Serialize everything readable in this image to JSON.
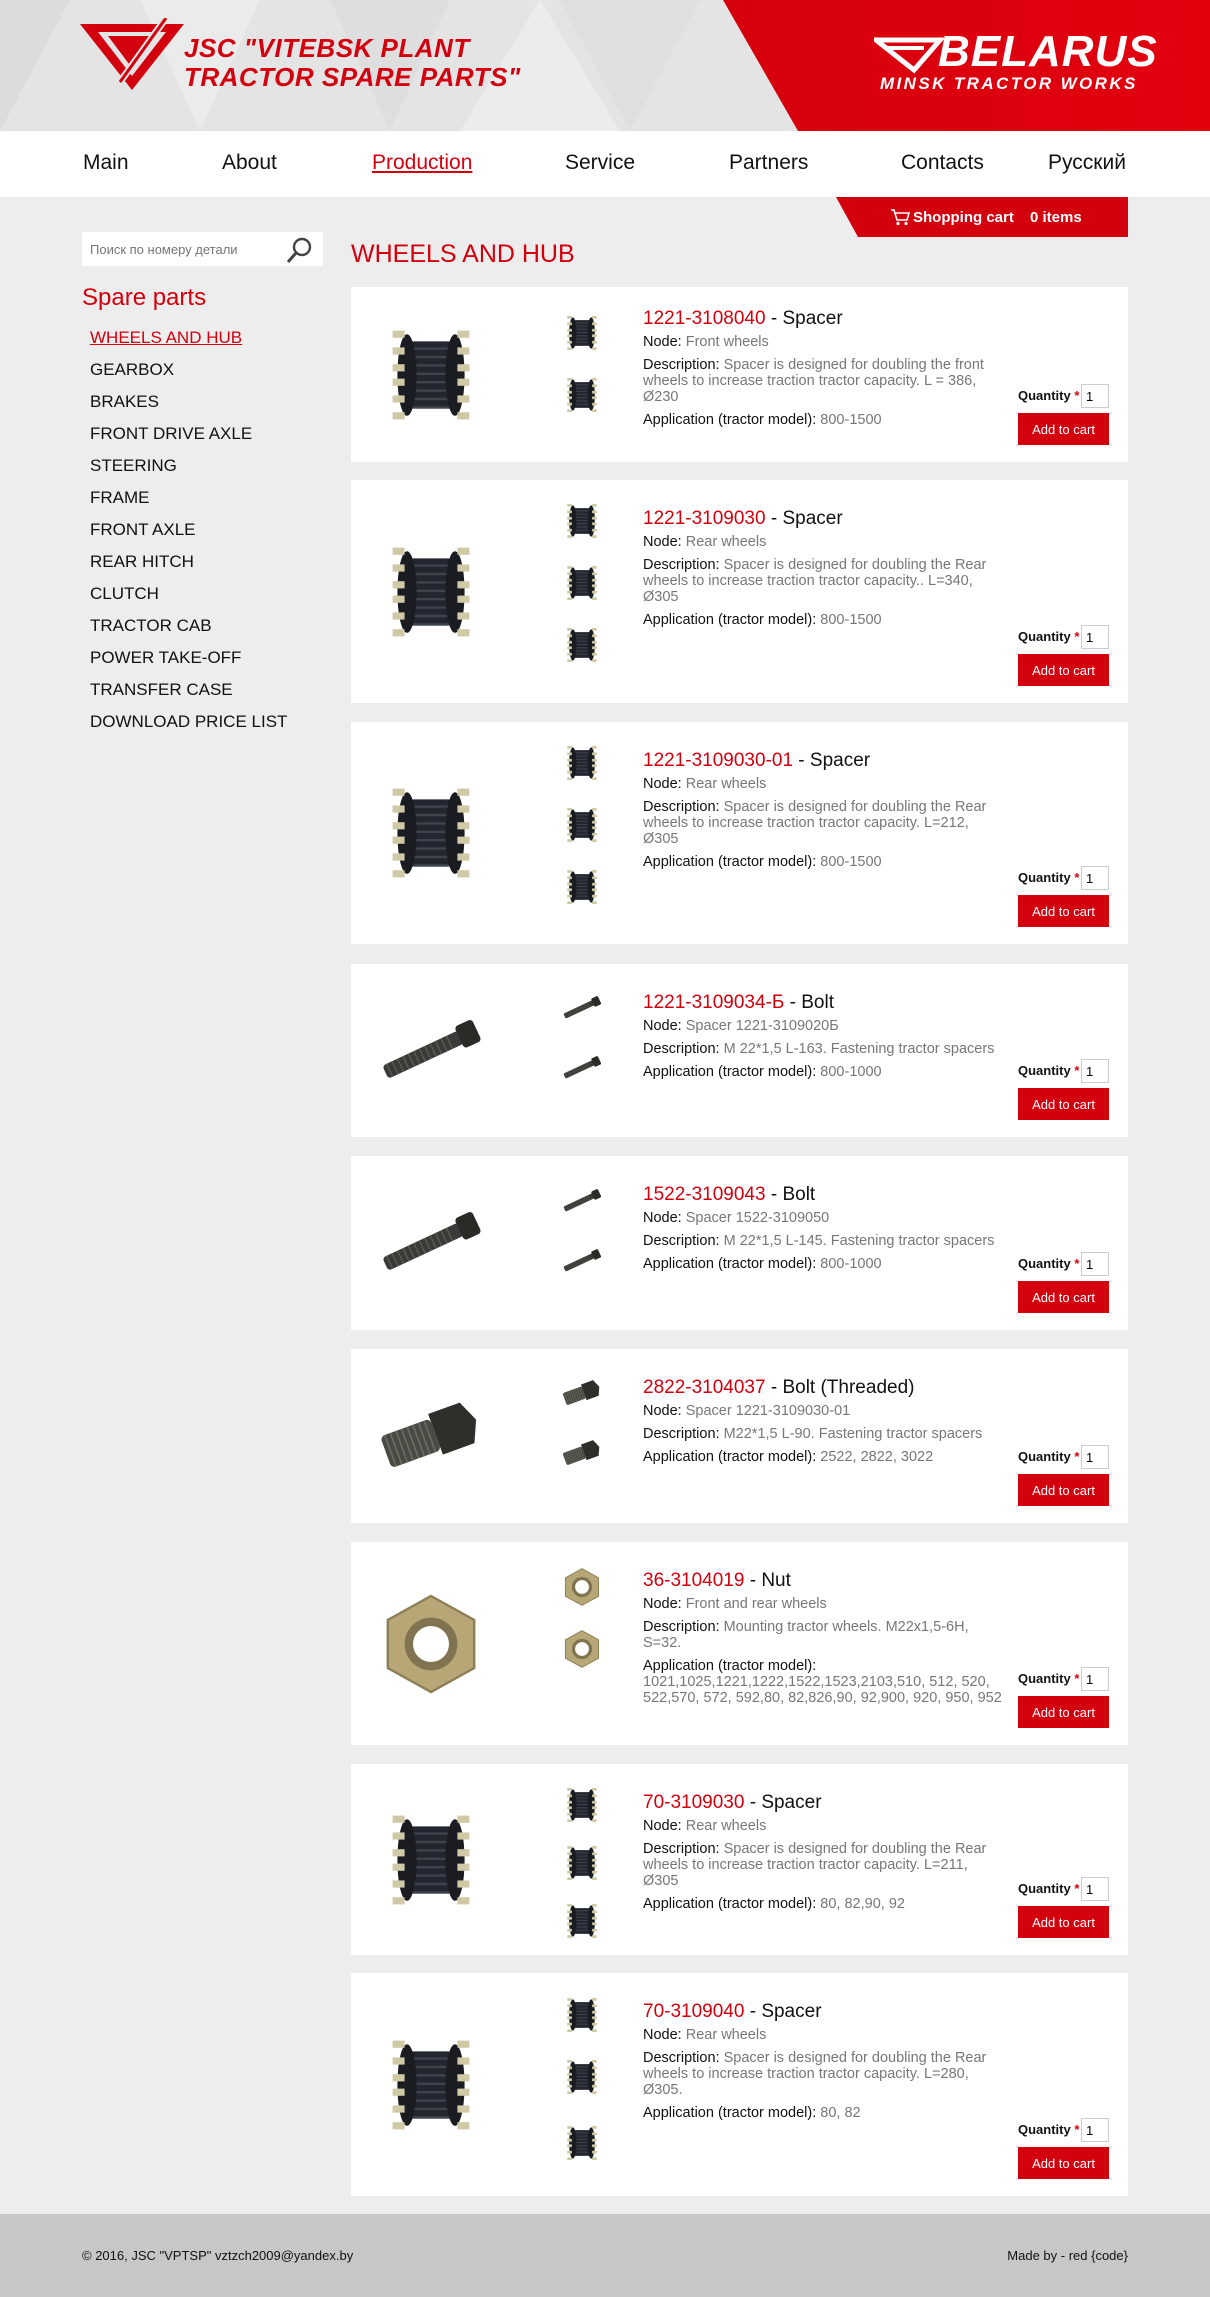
{
  "header": {
    "company_line1": "JSC \"VITEBSK PLANT",
    "company_line2": "TRACTOR SPARE PARTS\"",
    "brand_title": "BELARUS",
    "brand_subtitle": "MINSK TRACTOR WORKS",
    "logo_icon": "vptsp-logo-icon",
    "brand_icon": "belarus-logo-icon",
    "colors": {
      "accent": "#d3000e",
      "header_bg": "#e4e4e4"
    }
  },
  "nav": {
    "items": [
      "Main",
      "About",
      "Production",
      "Service",
      "Partners",
      "Contacts",
      "Русский"
    ],
    "active": "Production"
  },
  "cart": {
    "label": "Shopping cart",
    "count": "0 items",
    "icon": "shopping-cart-icon"
  },
  "search": {
    "placeholder": "Поиск по номеру детали",
    "icon": "search-icon"
  },
  "sidebar": {
    "title": "Spare parts",
    "items": [
      "WHEELS AND HUB",
      "GEARBOX",
      "BRAKES",
      "FRONT DRIVE AXLE",
      "STEERING",
      "FRAME",
      "FRONT AXLE",
      "REAR HITCH",
      "CLUTCH",
      "TRACTOR CAB",
      "POWER TAKE-OFF",
      "TRANSFER CASE",
      "DOWNLOAD PRICE LIST"
    ],
    "active": "WHEELS AND HUB"
  },
  "main": {
    "title": "WHEELS AND HUB",
    "labels": {
      "node": "Node:",
      "description": "Description:",
      "application": "Application (tractor model):",
      "quantity": "Quantity",
      "required": "*",
      "add_to_cart": "Add to cart"
    },
    "products": [
      {
        "code": "1221-3108040",
        "name": " - Spacer",
        "node": "Front wheels",
        "description": "Spacer is designed for doubling the front wheels to increase traction tractor capacity. L = 386, Ø230",
        "application": "800-1500",
        "qty": "1",
        "image": "spacer-icon"
      },
      {
        "code": "1221-3109030",
        "name": " - Spacer",
        "node": "Rear wheels",
        "description": "Spacer is designed for doubling the Rear wheels to increase traction tractor capacity.. L=340, Ø305",
        "application": "800-1500",
        "qty": "1",
        "image": "spacer-icon"
      },
      {
        "code": "1221-3109030-01",
        "name": " - Spacer",
        "node": "Rear wheels",
        "description": "Spacer is designed for doubling the Rear wheels to increase traction tractor capacity. L=212, Ø305",
        "application": "800-1500",
        "qty": "1",
        "image": "spacer-icon"
      },
      {
        "code": "1221-3109034-Б",
        "name": " - Bolt",
        "node": "Spacer 1221-3109020Б",
        "description": "M 22*1,5 L-163. Fastening tractor spacers",
        "application": "800-1000",
        "qty": "1",
        "image": "bolt-icon"
      },
      {
        "code": "1522-3109043",
        "name": " - Bolt",
        "node": "Spacer 1522-3109050",
        "description": "M 22*1,5 L-145. Fastening tractor spacers",
        "application": "800-1000",
        "qty": "1",
        "image": "bolt-icon"
      },
      {
        "code": "2822-3104037",
        "name": " - Bolt (Threaded)",
        "node": "Spacer 1221-3109030-01",
        "description": "M22*1,5 L-90. Fastening tractor spacers",
        "application": "2522, 2822, 3022",
        "qty": "1",
        "image": "threaded-bolt-icon"
      },
      {
        "code": "36-3104019",
        "name": " - Nut",
        "node": "Front and rear wheels",
        "description": "Mounting tractor wheels. M22x1,5-6H, S=32.",
        "application": "1021,1025,1221,1222,1522,1523,2103,510, 512, 520, 522,570, 572, 592,80, 82,826,90, 92,900, 920, 950, 952",
        "qty": "1",
        "image": "nut-icon"
      },
      {
        "code": "70-3109030",
        "name": " - Spacer",
        "node": "Rear wheels",
        "description": "Spacer is designed for doubling the Rear wheels to increase traction tractor capacity. L=211, Ø305",
        "application": "80, 82,90, 92",
        "qty": "1",
        "image": "spacer-icon"
      },
      {
        "code": "70-3109040",
        "name": " - Spacer",
        "node": "Rear wheels",
        "description": "Spacer is designed for doubling the Rear wheels to increase traction tractor capacity. L=280, Ø305.",
        "application": "80, 82",
        "qty": "1",
        "image": "spacer-icon"
      }
    ]
  },
  "footer": {
    "copyright": "© 2016, JSC \"VPTSP\" vztzch2009@yandex.by",
    "made_by": "Made by - red {code}"
  }
}
